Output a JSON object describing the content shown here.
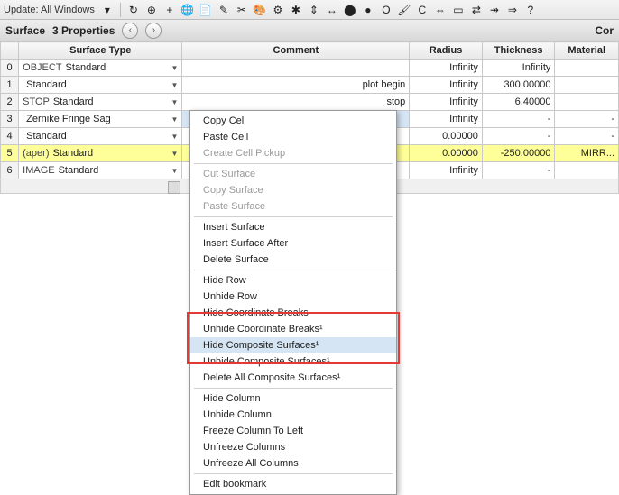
{
  "toolbar": {
    "update_label": "Update: All Windows",
    "dd_glyph": "▾",
    "icons": [
      "↻",
      "⊕",
      "+",
      "🌐",
      "📄",
      "✎",
      "✂",
      "🎨",
      "⚙",
      "✱",
      "⇕",
      "↔",
      "⬤",
      "●",
      "O",
      "🖌",
      "C",
      "⇔",
      "▭",
      "⇄",
      "↠",
      "⇒",
      "?"
    ]
  },
  "subbar": {
    "title1": "Surface",
    "title2": "3 Properties",
    "nav_prev": "‹",
    "nav_next": "›",
    "right": "Cor"
  },
  "grid": {
    "headers": {
      "idx": "",
      "stype": "Surface Type",
      "cmt": "Comment",
      "rad": "Radius",
      "thk": "Thickness",
      "mat": "Material"
    },
    "rows": [
      {
        "idx": "0",
        "label": "OBJECT",
        "type": "Standard",
        "cmt": "",
        "rad": "Infinity",
        "thk": "Infinity",
        "mat": "",
        "hl": false,
        "sel": false
      },
      {
        "idx": "1",
        "label": "",
        "type": "Standard",
        "cmt": "plot begin",
        "rad": "Infinity",
        "thk": "300.00000",
        "mat": "",
        "hl": false,
        "sel": false
      },
      {
        "idx": "2",
        "label": "STOP",
        "type": "Standard",
        "cmt": "stop",
        "rad": "Infinity",
        "thk": "6.40000",
        "mat": "",
        "hl": false,
        "sel": false
      },
      {
        "idx": "3",
        "label": "",
        "type": "Zernike Fringe Sag",
        "cmt": "",
        "rad": "Infinity",
        "thk": "-",
        "mat": "-",
        "hl": false,
        "sel": true
      },
      {
        "idx": "4",
        "label": "",
        "type": "Standard",
        "cmt": "",
        "rad": "0.00000",
        "thk": "-",
        "mat": "-",
        "hl": false,
        "sel": false
      },
      {
        "idx": "5",
        "label": "(aper)",
        "type": "Standard",
        "cmt": "",
        "rad": "0.00000",
        "thk": "-250.00000",
        "mat": "MIRR...",
        "hl": true,
        "sel": false
      },
      {
        "idx": "6",
        "label": "IMAGE",
        "type": "Standard",
        "cmt": "",
        "rad": "Infinity",
        "thk": "-",
        "mat": "",
        "hl": false,
        "sel": false
      }
    ]
  },
  "ctx": [
    {
      "t": "item",
      "label": "Copy Cell",
      "disabled": false,
      "hover": false
    },
    {
      "t": "item",
      "label": "Paste Cell",
      "disabled": false,
      "hover": false
    },
    {
      "t": "item",
      "label": "Create Cell Pickup",
      "disabled": true,
      "hover": false
    },
    {
      "t": "sep"
    },
    {
      "t": "item",
      "label": "Cut Surface",
      "disabled": true,
      "hover": false
    },
    {
      "t": "item",
      "label": "Copy Surface",
      "disabled": true,
      "hover": false
    },
    {
      "t": "item",
      "label": "Paste Surface",
      "disabled": true,
      "hover": false
    },
    {
      "t": "sep"
    },
    {
      "t": "item",
      "label": "Insert Surface",
      "disabled": false,
      "hover": false
    },
    {
      "t": "item",
      "label": "Insert Surface After",
      "disabled": false,
      "hover": false
    },
    {
      "t": "item",
      "label": "Delete Surface",
      "disabled": false,
      "hover": false
    },
    {
      "t": "sep"
    },
    {
      "t": "item",
      "label": "Hide Row",
      "disabled": false,
      "hover": false
    },
    {
      "t": "item",
      "label": "Unhide Row",
      "disabled": false,
      "hover": false
    },
    {
      "t": "item",
      "label": "Hide Coordinate Breaks",
      "disabled": false,
      "hover": false
    },
    {
      "t": "item",
      "label": "Unhide Coordinate Breaks¹",
      "disabled": false,
      "hover": false
    },
    {
      "t": "item",
      "label": "Hide Composite Surfaces¹",
      "disabled": false,
      "hover": true
    },
    {
      "t": "item",
      "label": "Unhide Composite Surfaces¹",
      "disabled": false,
      "hover": false
    },
    {
      "t": "item",
      "label": "Delete All Composite Surfaces¹",
      "disabled": false,
      "hover": false
    },
    {
      "t": "sep"
    },
    {
      "t": "item",
      "label": "Hide Column",
      "disabled": false,
      "hover": false
    },
    {
      "t": "item",
      "label": "Unhide Column",
      "disabled": false,
      "hover": false
    },
    {
      "t": "item",
      "label": "Freeze Column To Left",
      "disabled": false,
      "hover": false
    },
    {
      "t": "item",
      "label": "Unfreeze Columns",
      "disabled": false,
      "hover": false
    },
    {
      "t": "item",
      "label": "Unfreeze All Columns",
      "disabled": false,
      "hover": false
    },
    {
      "t": "sep"
    },
    {
      "t": "item",
      "label": "Edit bookmark",
      "disabled": false,
      "hover": false
    }
  ]
}
